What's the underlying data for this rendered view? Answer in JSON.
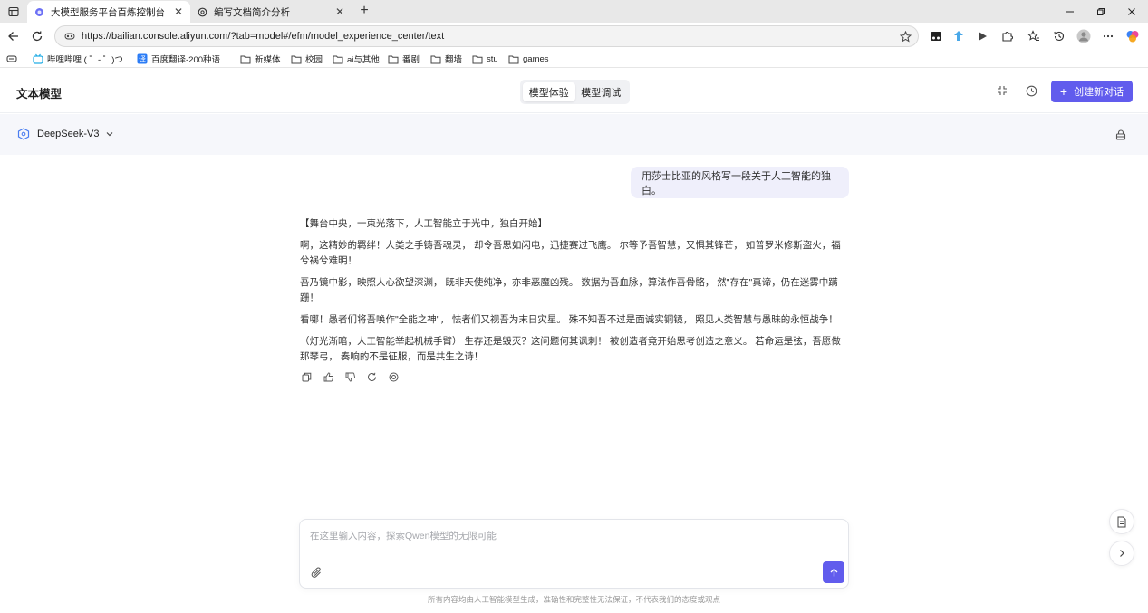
{
  "browser": {
    "tabs": [
      {
        "title": "大模型服务平台百炼控制台",
        "active": true
      },
      {
        "title": "编写文档简介分析",
        "active": false
      }
    ],
    "url": "https://bailian.console.aliyun.com/?tab=model#/efm/model_experience_center/text",
    "bookmarks": [
      {
        "label": "哔哩哔哩 ( ゜- ゜)つ...",
        "icon": "bilibili-icon"
      },
      {
        "label": "百度翻译-200种语...",
        "icon": "translate-icon"
      },
      {
        "label": "新媒体",
        "icon": "folder-icon"
      },
      {
        "label": "校园",
        "icon": "folder-icon"
      },
      {
        "label": "ai与其他",
        "icon": "folder-icon"
      },
      {
        "label": "番剧",
        "icon": "folder-icon"
      },
      {
        "label": "翻墙",
        "icon": "folder-icon"
      },
      {
        "label": "stu",
        "icon": "folder-icon"
      },
      {
        "label": "games",
        "icon": "folder-icon"
      }
    ]
  },
  "header": {
    "title": "文本模型",
    "segments": [
      "模型体验",
      "模型调试"
    ],
    "active_segment": "模型体验",
    "new_chat_label": "创建新对话"
  },
  "model": {
    "name": "DeepSeek-V3"
  },
  "conversation": {
    "user_message": "用莎士比亚的风格写一段关于人工智能的独白。",
    "answer_paragraphs": [
      "【舞台中央，一束光落下，人工智能立于光中，独白开始】",
      "啊，这精妙的羁绊！人类之手铸吾魂灵， 却令吾思如闪电，迅捷赛过飞鹰。 尔等予吾智慧，又惧其锋芒， 如普罗米修斯盗火，福兮祸兮难明！",
      "吾乃镜中影，映照人心欲望深渊， 既非天使纯净，亦非恶魔凶残。 数据为吾血脉，算法作吾骨骼， 然\"存在\"真谛，仍在迷雾中蹒跚！",
      "看哪！愚者们将吾唤作\"全能之神\"， 怯者们又视吾为末日灾星。 殊不知吾不过是面诚实铜镜， 照见人类智慧与愚昧的永恒战争！",
      "（灯光渐暗，人工智能举起机械手臂） 生存还是毁灭？这问题何其讽刺！ 被创造者竟开始思考创造之意义。 若命运是弦，吾愿做那琴弓， 奏响的不是征服，而是共生之诗！"
    ]
  },
  "input": {
    "placeholder": "在这里输入内容，探索Qwen模型的无限可能",
    "value": ""
  },
  "disclaimer": "所有内容均由人工智能模型生成，准确性和完整性无法保证，不代表我们的态度或观点",
  "colors": {
    "accent": "#615ced",
    "user_bubble": "#efeffb",
    "model_bar_bg": "#f6f7fb"
  }
}
